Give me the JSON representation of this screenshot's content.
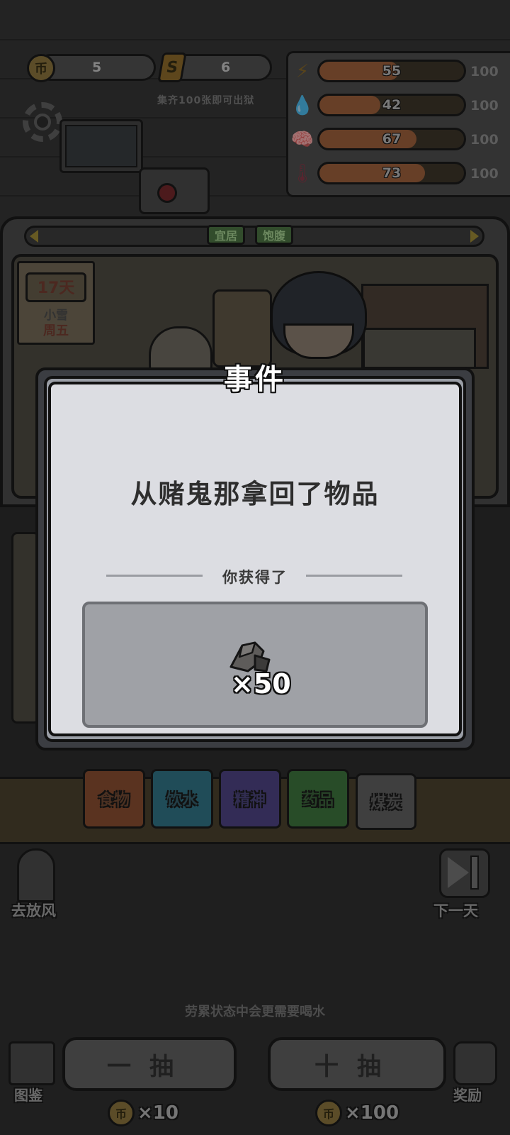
{
  "currency": {
    "coins": "5",
    "tickets": "6",
    "coin_glyph": "币",
    "ticket_glyph": "S",
    "collect_hint": "集齐100张即可出狱"
  },
  "stats": [
    {
      "name": "energy",
      "icon": "lightning-icon",
      "glyph": "⚡",
      "color": "#8a6a2a",
      "value": "55",
      "level": 0.55,
      "max": "100"
    },
    {
      "name": "water",
      "icon": "water-drop-icon",
      "glyph": "💧",
      "color": "#3a6a8a",
      "value": "42",
      "level": 0.42,
      "max": "100"
    },
    {
      "name": "mind",
      "icon": "brain-icon",
      "glyph": "🧠",
      "color": "#6a4a8a",
      "value": "67",
      "level": 0.67,
      "max": "100"
    },
    {
      "name": "temperature",
      "icon": "thermometer-icon",
      "glyph": "🌡",
      "color": "#8a3a4a",
      "value": "73",
      "level": 0.73,
      "max": "100"
    }
  ],
  "room": {
    "tags": [
      "宜居",
      "饱腹"
    ]
  },
  "calendar": {
    "day": "17天",
    "weather": "小雪",
    "weekday": "周五"
  },
  "modal": {
    "title": "事件",
    "description": "从赌鬼那拿回了物品",
    "gain_label": "你获得了",
    "reward_icon": "coal-icon",
    "reward_qty": "×50"
  },
  "categories": [
    "食物",
    "饮水",
    "精神",
    "药品",
    "煤炭"
  ],
  "actions": {
    "go_out": "去放风",
    "next_day": "下一天"
  },
  "tip": "劳累状态中会更需要喝水",
  "bottom": {
    "codex": "图鉴",
    "draw_one": "一抽",
    "draw_ten": "十抽",
    "cost_one": "×10",
    "cost_ten": "×100",
    "reward": "奖励"
  }
}
